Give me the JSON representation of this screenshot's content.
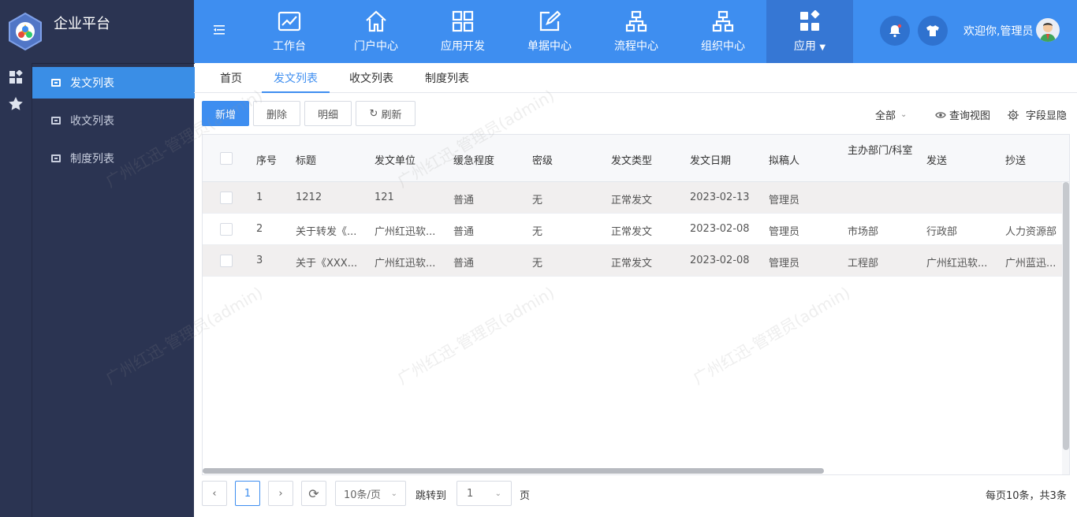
{
  "app": {
    "title": "企业平台"
  },
  "topnav": {
    "items": [
      {
        "label": "工作台"
      },
      {
        "label": "门户中心"
      },
      {
        "label": "应用开发"
      },
      {
        "label": "单据中心"
      },
      {
        "label": "流程中心"
      },
      {
        "label": "组织中心"
      },
      {
        "label": "应用"
      }
    ],
    "welcome": "欢迎你,管理员"
  },
  "sidebar": {
    "items": [
      {
        "label": "发文列表"
      },
      {
        "label": "收文列表"
      },
      {
        "label": "制度列表"
      }
    ]
  },
  "tabs": [
    {
      "label": "首页"
    },
    {
      "label": "发文列表"
    },
    {
      "label": "收文列表"
    },
    {
      "label": "制度列表"
    }
  ],
  "toolbar": {
    "add": "新增",
    "delete": "删除",
    "detail": "明细",
    "refresh": "刷新",
    "filter": "全部",
    "query_view": "查询视图",
    "field_toggle": "字段显隐"
  },
  "table": {
    "columns": [
      "序号",
      "标题",
      "发文单位",
      "缓急程度",
      "密级",
      "发文类型",
      "发文日期",
      "拟稿人",
      "主办部门/科室",
      "发送",
      "抄送"
    ],
    "rows": [
      [
        "1",
        "1212",
        "121",
        "普通",
        "无",
        "正常发文",
        "2023-02-13",
        "管理员",
        "",
        "",
        ""
      ],
      [
        "2",
        "关于转发《...",
        "广州红迅软...",
        "普通",
        "无",
        "正常发文",
        "2023-02-08",
        "管理员",
        "市场部",
        "行政部",
        "人力资源部"
      ],
      [
        "3",
        "关于《XXX...",
        "广州红迅软...",
        "普通",
        "无",
        "正常发文",
        "2023-02-08",
        "管理员",
        "工程部",
        "广州红迅软...",
        "广州蓝迅..."
      ]
    ]
  },
  "pagination": {
    "current": "1",
    "page_size": "10条/页",
    "jump_label": "跳转到",
    "jump_value": "1",
    "page_suffix": "页",
    "summary": "每页10条，共3条"
  },
  "watermark": "广州红迅-管理员(admin)",
  "colors": {
    "primary": "#3e8ef0",
    "sidebar": "#2b3452",
    "active_nav": "#3677d4"
  }
}
